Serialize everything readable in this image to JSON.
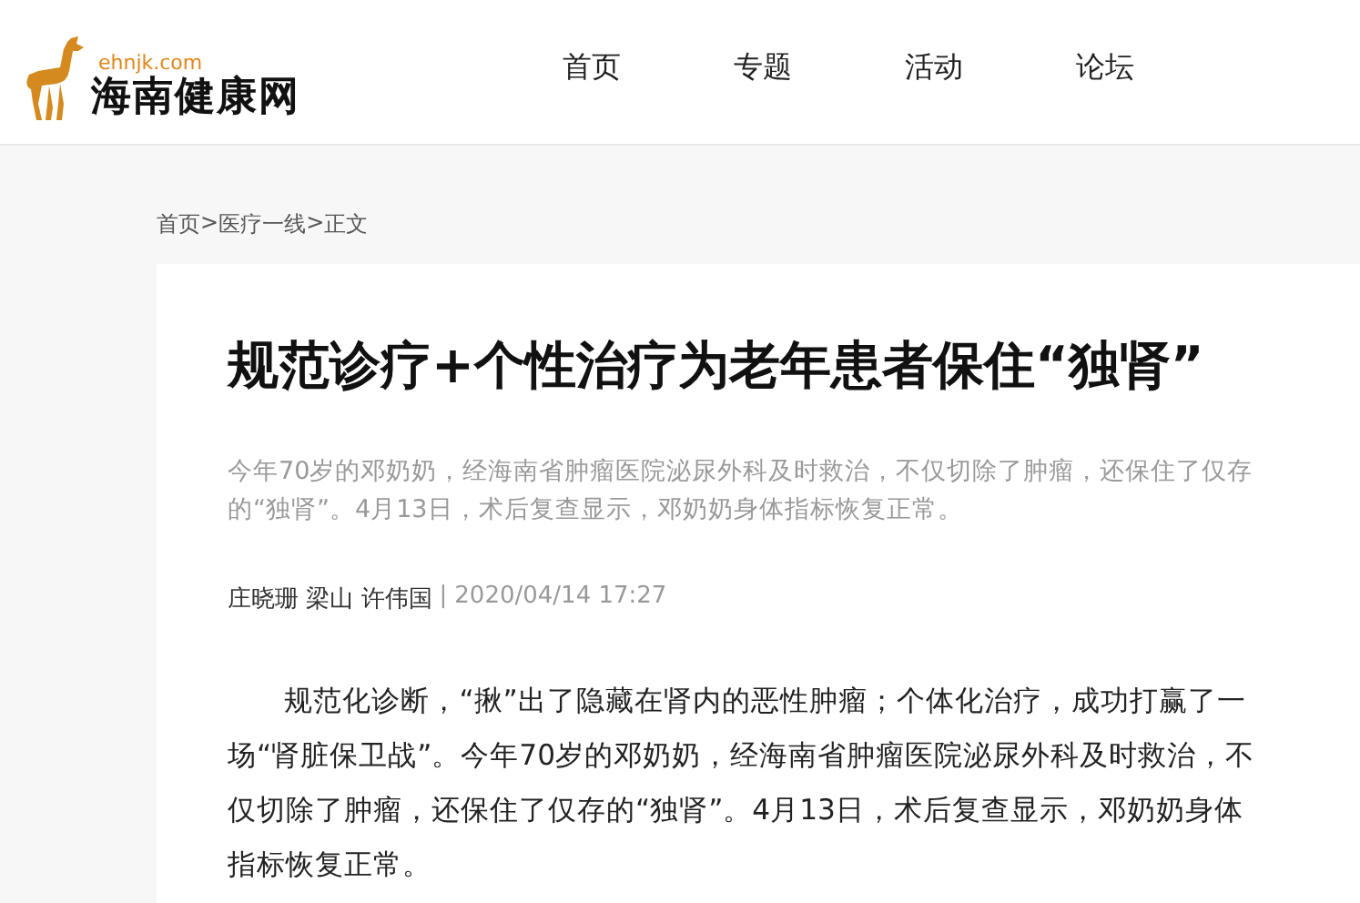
{
  "logo": {
    "domain": "ehnjk.com",
    "name": "海南健康网"
  },
  "nav": [
    {
      "label": "首页"
    },
    {
      "label": "专题"
    },
    {
      "label": "活动"
    },
    {
      "label": "论坛"
    }
  ],
  "breadcrumb": [
    {
      "label": "首页"
    },
    {
      "label": "医疗一线"
    },
    {
      "label": "正文"
    }
  ],
  "breadcrumb_separator": ">",
  "article": {
    "title": "规范诊疗+个性治疗为老年患者保住“独肾”",
    "summary": "今年70岁的邓奶奶，经海南省肿瘤医院泌尿外科及时救治，不仅切除了肿瘤，还保住了仅存的“独肾”。4月13日，术后复查显示，邓奶奶身体指标恢复正常。",
    "authors": "庄晓珊 梁山 许伟国",
    "meta_separator": "|",
    "date": "2020/04/14 17:27",
    "paragraphs": [
      "规范化诊断，“揪”出了隐藏在肾内的恶性肿瘤；个体化治疗，成功打赢了一场“肾脏保卫战”。今年70岁的邓奶奶，经海南省肿瘤医院泌尿外科及时救治，不仅切除了肿瘤，还保住了仅存的“独肾”。4月13日，术后复查显示，邓奶奶身体指标恢复正常。"
    ]
  }
}
